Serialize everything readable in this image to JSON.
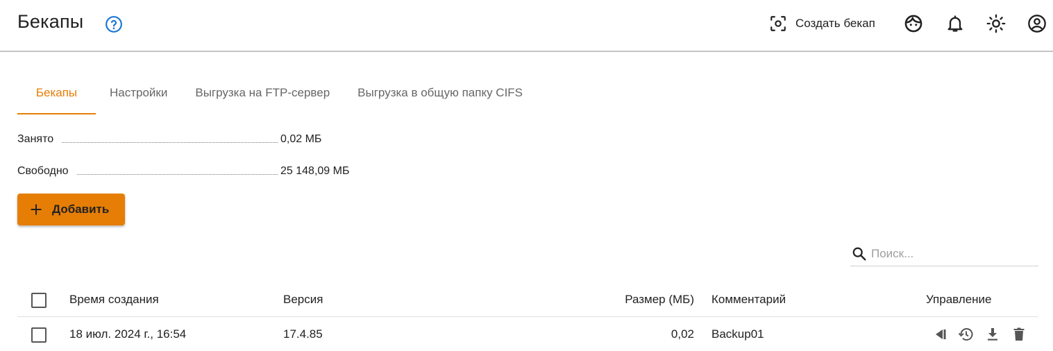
{
  "header": {
    "title": "Бекапы",
    "create_backup_label": "Создать бекап"
  },
  "tabs": [
    {
      "label": "Бекапы",
      "active": true
    },
    {
      "label": "Настройки",
      "active": false
    },
    {
      "label": "Выгрузка на FTP-сервер",
      "active": false
    },
    {
      "label": "Выгрузка в общую папку CIFS",
      "active": false
    }
  ],
  "stats": {
    "used_label": "Занято",
    "used_value": "0,02 МБ",
    "free_label": "Свободно",
    "free_value": "25 148,09 МБ"
  },
  "add_button": {
    "label": "Добавить"
  },
  "search": {
    "placeholder": "Поиск..."
  },
  "table": {
    "columns": [
      "Время создания",
      "Версия",
      "Размер (МБ)",
      "Комментарий",
      "Управление"
    ],
    "rows": [
      {
        "created": "18 июл. 2024 г., 16:54",
        "version": "17.4.85",
        "size": "0,02",
        "comment": "Backup01"
      }
    ]
  },
  "colors": {
    "accent": "#e67e05",
    "help_icon": "#1976d2"
  },
  "icons": {
    "help": "help-circle-icon",
    "create_backup": "screenshot-frame-icon",
    "face": "face-icon",
    "notifications": "bell-icon",
    "theme": "sun-icon",
    "account": "account-circle-icon",
    "search": "search-icon",
    "add": "plus-icon",
    "row_actions": [
      "restore-version-icon",
      "history-icon",
      "download-icon",
      "delete-icon"
    ]
  }
}
